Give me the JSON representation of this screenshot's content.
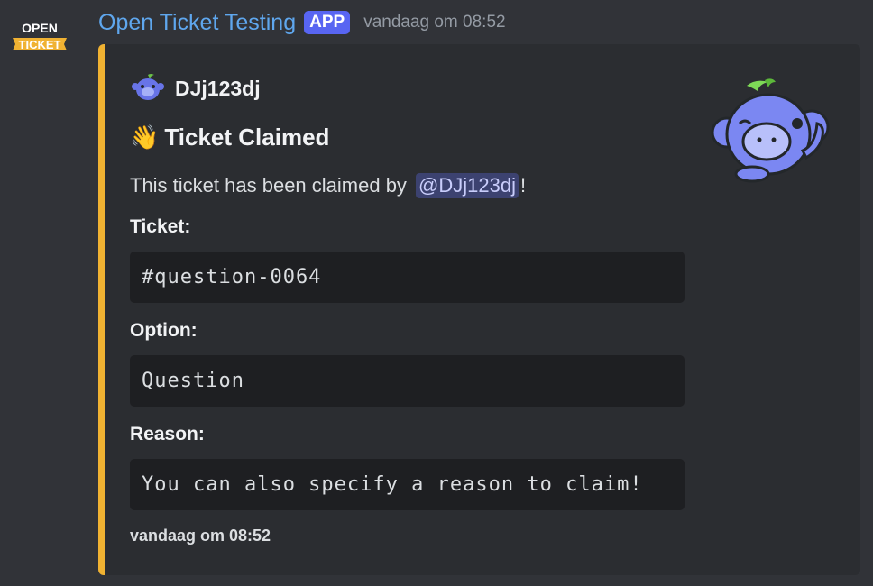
{
  "message": {
    "author_name": "Open Ticket Testing",
    "app_badge": "APP",
    "timestamp": "vandaag om 08:52",
    "avatar_text": {
      "line1": "OPEN",
      "line2": "TICKET"
    },
    "icons": {
      "avatar": "open-ticket-logo",
      "embed_author": "wumpus-icon",
      "thumbnail": "wumpus-waving-icon",
      "title": "waving-hand-icon"
    }
  },
  "embed": {
    "accent_color": "#f0b232",
    "author": "DJj123dj",
    "title_emoji": "👋",
    "title": "Ticket Claimed",
    "description_prefix": "This ticket has been claimed by ",
    "mention": "@DJj123dj",
    "description_suffix": "!",
    "fields": [
      {
        "name": "Ticket:",
        "value": "#question-0064"
      },
      {
        "name": "Option:",
        "value": "Question"
      },
      {
        "name": "Reason:",
        "value": "You can also specify a reason to claim!"
      }
    ],
    "footer": "vandaag om 08:52"
  }
}
